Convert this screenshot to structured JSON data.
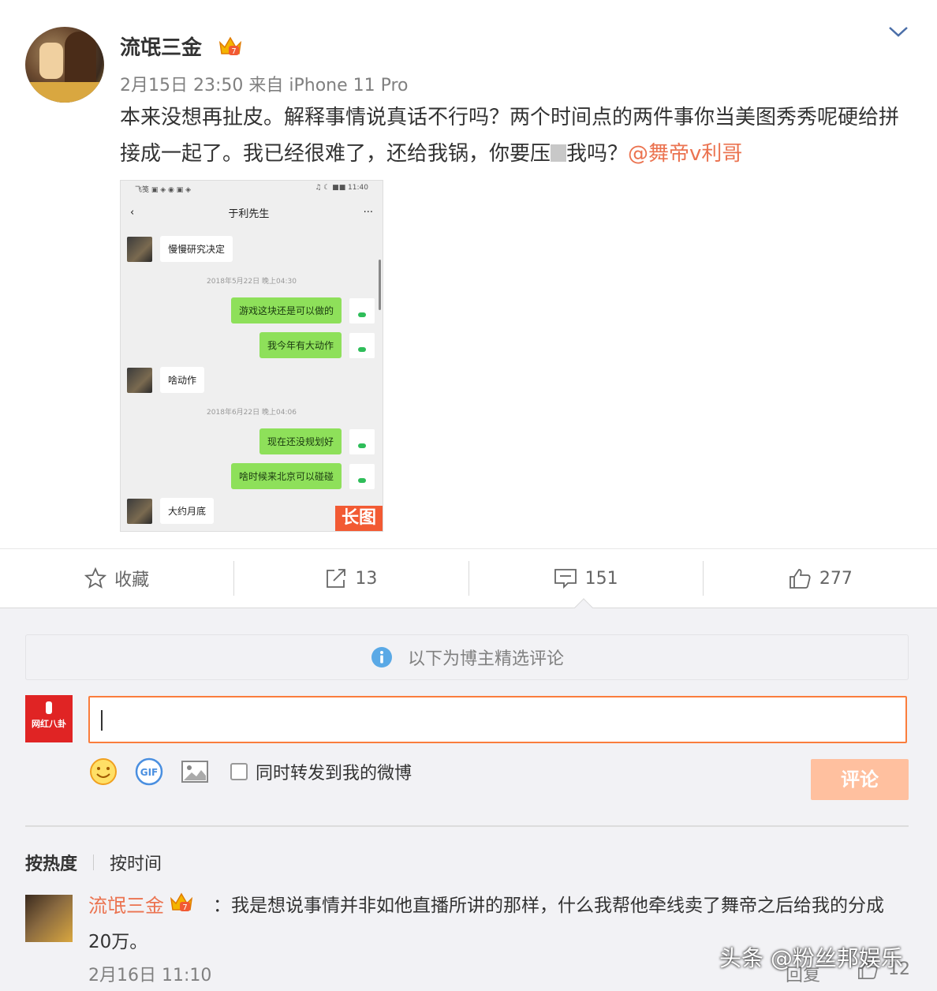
{
  "post": {
    "username": "流氓三金",
    "meta": "2月15日 23:50 来自 iPhone 11 Pro",
    "content_text": "本来没想再扯皮。解释事情说真话不行吗？两个时间点的两件事你当美图秀秀呢硬给拼接成一起了。我已经很难了，还给我锅，你要压",
    "content_text_2": "我吗？",
    "mention": "@舞帝v利哥",
    "image": {
      "status_left": "飞笺 ▣ ◈ ◉ ▣ ◈",
      "status_right": "♫ ☾ ■■ 11:40",
      "chat_title": "于利先生",
      "messages": [
        {
          "side": "left",
          "text": "慢慢研究决定"
        },
        {
          "side": "time",
          "text": "2018年5月22日 晚上04:30"
        },
        {
          "side": "right",
          "text": "游戏这块还是可以做的"
        },
        {
          "side": "right",
          "text": "我今年有大动作"
        },
        {
          "side": "left",
          "text": "啥动作"
        },
        {
          "side": "time",
          "text": "2018年6月22日 晚上04:06"
        },
        {
          "side": "right",
          "text": "现在还没规划好"
        },
        {
          "side": "right",
          "text": "啥时候来北京可以碰碰"
        },
        {
          "side": "left",
          "text": "大约月底"
        }
      ],
      "long_tag": "长图"
    }
  },
  "actions": {
    "favorite": "收藏",
    "repost": "13",
    "comment": "151",
    "like": "277"
  },
  "comments": {
    "notice": "以下为博主精选评论",
    "my_avatar_text": "网红八卦",
    "input_value": "",
    "sync_label": "同时转发到我的微博",
    "submit": "评论",
    "sort_hot": "按热度",
    "sort_time": "按时间",
    "item": {
      "user": "流氓三金",
      "text": "：我是想说事情并非如他直播所讲的那样，什么我帮他牵线卖了舞帝之后给我的分成20万。",
      "time": "2月16日 11:10",
      "reply": "回复",
      "likes": "12"
    }
  },
  "watermark": "头条 @粉丝邦娱乐",
  "colors": {
    "accent": "#eb7350",
    "input_border": "#fa7d3c",
    "submit_bg": "#ffc09f",
    "bubble_green": "#8ee05a"
  }
}
